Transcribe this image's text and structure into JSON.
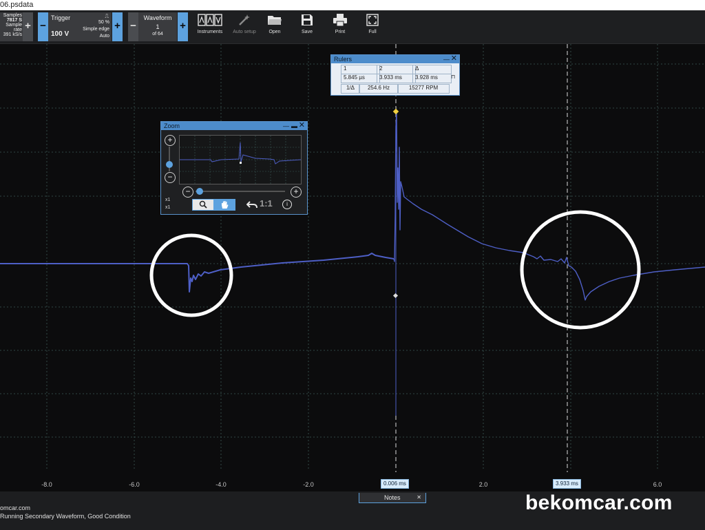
{
  "window": {
    "title": "06.psdata"
  },
  "toolbar": {
    "samples": {
      "label": "Samples",
      "value": "7817 S",
      "rate_label": "Sample rate",
      "rate_value": "391 kS/s"
    },
    "trigger": {
      "label": "Trigger",
      "value": "100 V",
      "level": "50 %",
      "mode": "Simple edge",
      "auto": "Auto"
    },
    "waveform": {
      "label": "Waveform",
      "index": "1",
      "of": "of 64"
    },
    "buttons": {
      "instruments": "Instruments",
      "auto_setup": "Auto setup",
      "open": "Open",
      "save": "Save",
      "print": "Print",
      "full": "Full"
    }
  },
  "rulers": {
    "title": "Rulers",
    "col1": "1",
    "col2": "2",
    "delta": "Δ",
    "r1": "5.845 µs",
    "r2": "3.933 ms",
    "rdelta": "3.928 ms",
    "inv_label": "1/Δ",
    "freq": "254.6 Hz",
    "rpm": "15277 RPM"
  },
  "zoom": {
    "title": "Zoom",
    "ratio": "1:1",
    "x1": "x1",
    "x2": "x1"
  },
  "axis": {
    "ticks": [
      "-8.0",
      "-6.0",
      "-4.0",
      "-2.0",
      "2.0",
      "6.0"
    ]
  },
  "cursors": {
    "c1": "0.006 ms",
    "c2": "3.933 ms"
  },
  "notes": {
    "label": "Notes"
  },
  "status": {
    "line1": "omcar.com",
    "line2": "Running Secondary Waveform, Good Condition"
  },
  "watermark": "bekomcar.com",
  "colors": {
    "trace": "#4e5fc6",
    "accent": "#5da2df",
    "grid": "#3d5a58"
  }
}
